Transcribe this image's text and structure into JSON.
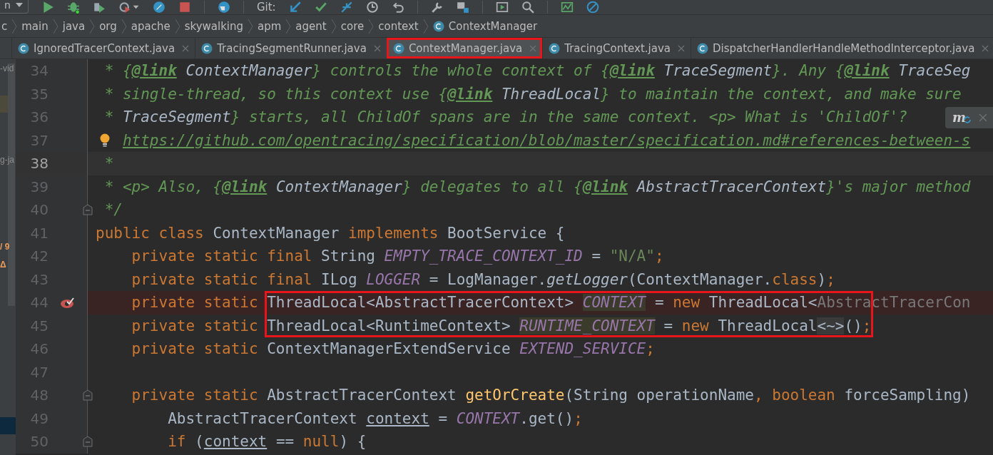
{
  "toolbar": {
    "config_selector": "n",
    "git_label": "Git:"
  },
  "breadcrumbs": [
    "c",
    "main",
    "java",
    "org",
    "apache",
    "skywalking",
    "apm",
    "agent",
    "core",
    "context",
    "ContextManager"
  ],
  "tabs": [
    {
      "label": "IgnoredTracerContext.java",
      "selected": false,
      "highlighted": false
    },
    {
      "label": "TracingSegmentRunner.java",
      "selected": false,
      "highlighted": false
    },
    {
      "label": "ContextManager.java",
      "selected": true,
      "highlighted": true
    },
    {
      "label": "TracingContext.java",
      "selected": false,
      "highlighted": false
    },
    {
      "label": "DispatcherHandlerHandleMethodInterceptor.java",
      "selected": false,
      "highlighted": false
    }
  ],
  "project_panel": {
    "fragments": [
      {
        "text": "-vid",
        "kind": "name"
      },
      {
        "text": "g-ja",
        "kind": "name"
      },
      {
        "text": "/ 9",
        "kind": "count"
      },
      {
        "text": "Δ",
        "kind": "count"
      }
    ]
  },
  "popup": {
    "glyph": "m"
  },
  "lines": [
    {
      "number": "34",
      "current": false,
      "breakpoint": false,
      "boxed": false,
      "bulb": false,
      "fold": false,
      "tokens": [
        {
          "kind": "cm",
          "text": " * {"
        },
        {
          "kind": "tag",
          "text": "@link"
        },
        {
          "kind": "ref",
          "text": " ContextManager"
        },
        {
          "kind": "cm",
          "text": "} controls the whole context of {"
        },
        {
          "kind": "tag",
          "text": "@link"
        },
        {
          "kind": "ref",
          "text": " TraceSegment"
        },
        {
          "kind": "cm",
          "text": "}. Any {"
        },
        {
          "kind": "tag",
          "text": "@link"
        },
        {
          "kind": "ref",
          "text": " TraceSeg"
        }
      ]
    },
    {
      "number": "35",
      "current": false,
      "breakpoint": false,
      "boxed": false,
      "bulb": false,
      "fold": false,
      "tokens": [
        {
          "kind": "cm",
          "text": " * single-thread, so this context use {"
        },
        {
          "kind": "tag",
          "text": "@link"
        },
        {
          "kind": "ref",
          "text": " ThreadLocal"
        },
        {
          "kind": "cm",
          "text": "} to maintain the context, and make sure"
        }
      ]
    },
    {
      "number": "36",
      "current": false,
      "breakpoint": false,
      "boxed": false,
      "bulb": false,
      "fold": false,
      "tokens": [
        {
          "kind": "cm",
          "text": " * "
        },
        {
          "kind": "ref",
          "text": "TraceSegment"
        },
        {
          "kind": "cm",
          "text": "} starts, all ChildOf spans are in the same context. <p> What is 'ChildOf'?"
        }
      ]
    },
    {
      "number": "37",
      "current": false,
      "breakpoint": false,
      "boxed": false,
      "bulb": true,
      "fold": false,
      "tokens": [
        {
          "kind": "url",
          "text": "https://github.com/opentracing/specification/blob/master/specification.md#references-between-s"
        }
      ]
    },
    {
      "number": "38",
      "current": true,
      "breakpoint": false,
      "boxed": false,
      "bulb": false,
      "fold": false,
      "tokens": [
        {
          "kind": "cm",
          "text": " *"
        }
      ]
    },
    {
      "number": "39",
      "current": false,
      "breakpoint": false,
      "boxed": false,
      "bulb": false,
      "fold": false,
      "tokens": [
        {
          "kind": "cm",
          "text": " * <p> Also, {"
        },
        {
          "kind": "tag",
          "text": "@link"
        },
        {
          "kind": "ref",
          "text": " ContextManager"
        },
        {
          "kind": "cm",
          "text": "} delegates to all {"
        },
        {
          "kind": "tag",
          "text": "@link"
        },
        {
          "kind": "ref",
          "text": " AbstractTracerContext"
        },
        {
          "kind": "cm",
          "text": "}'s major method"
        }
      ]
    },
    {
      "number": "40",
      "current": false,
      "breakpoint": false,
      "boxed": false,
      "bulb": false,
      "fold": true,
      "tokens": [
        {
          "kind": "cm",
          "text": " */"
        }
      ]
    },
    {
      "number": "41",
      "current": false,
      "breakpoint": false,
      "boxed": false,
      "bulb": false,
      "fold": false,
      "tokens": [
        {
          "kind": "kw",
          "text": "public class "
        },
        {
          "kind": "plain",
          "text": "ContextManager "
        },
        {
          "kind": "kw",
          "text": "implements "
        },
        {
          "kind": "plain",
          "text": "BootService {"
        }
      ]
    },
    {
      "number": "42",
      "current": false,
      "breakpoint": false,
      "boxed": false,
      "bulb": false,
      "fold": false,
      "tokens": [
        {
          "kind": "kw",
          "text": "    private static final "
        },
        {
          "kind": "plain",
          "text": "String "
        },
        {
          "kind": "field",
          "text": "EMPTY_TRACE_CONTEXT_ID"
        },
        {
          "kind": "plain",
          "text": " = "
        },
        {
          "kind": "str",
          "text": "\"N/A\""
        },
        {
          "kind": "kw",
          "text": ";"
        }
      ]
    },
    {
      "number": "43",
      "current": false,
      "breakpoint": false,
      "boxed": false,
      "bulb": false,
      "fold": false,
      "tokens": [
        {
          "kind": "kw",
          "text": "    private static final "
        },
        {
          "kind": "plain",
          "text": "ILog "
        },
        {
          "kind": "field",
          "text": "LOGGER"
        },
        {
          "kind": "plain",
          "text": " = LogManager."
        },
        {
          "kind": "call",
          "text": "getLogger"
        },
        {
          "kind": "plain",
          "text": "(ContextManager."
        },
        {
          "kind": "kw",
          "text": "class"
        },
        {
          "kind": "plain",
          "text": ")"
        },
        {
          "kind": "kw",
          "text": ";"
        }
      ]
    },
    {
      "number": "44",
      "current": false,
      "breakpoint": true,
      "boxed": true,
      "bulb": false,
      "fold": false,
      "tokens": [
        {
          "kind": "kw",
          "text": "    private static "
        },
        {
          "kind": "plain",
          "text": "ThreadLocal<AbstractTracerContext> "
        },
        {
          "kind": "usage",
          "text": "CONTEXT"
        },
        {
          "kind": "plain",
          "text": " = "
        },
        {
          "kind": "kw",
          "text": "new "
        },
        {
          "kind": "plain",
          "text": "ThreadLocal<"
        },
        {
          "kind": "dim",
          "text": "AbstractTracerCon"
        }
      ]
    },
    {
      "number": "45",
      "current": false,
      "breakpoint": false,
      "boxed": true,
      "bulb": false,
      "fold": false,
      "tokens": [
        {
          "kind": "kw",
          "text": "    private static "
        },
        {
          "kind": "plain",
          "text": "ThreadLocal<RuntimeContext> "
        },
        {
          "kind": "usage",
          "text": "RUNTIME_CONTEXT"
        },
        {
          "kind": "plain",
          "text": " = "
        },
        {
          "kind": "kw",
          "text": "new "
        },
        {
          "kind": "plain",
          "text": "ThreadLocal"
        },
        {
          "kind": "fold",
          "text": "<~>"
        },
        {
          "kind": "plain",
          "text": "()"
        },
        {
          "kind": "kw",
          "text": ";"
        }
      ]
    },
    {
      "number": "46",
      "current": false,
      "breakpoint": false,
      "boxed": false,
      "bulb": false,
      "fold": false,
      "tokens": [
        {
          "kind": "kw",
          "text": "    private static "
        },
        {
          "kind": "plain",
          "text": "ContextManagerExtendService "
        },
        {
          "kind": "field",
          "text": "EXTEND_SERVICE"
        },
        {
          "kind": "kw",
          "text": ";"
        }
      ]
    },
    {
      "number": "47",
      "current": false,
      "breakpoint": false,
      "boxed": false,
      "bulb": false,
      "fold": false
    },
    {
      "number": "48",
      "current": false,
      "breakpoint": false,
      "boxed": false,
      "bulb": false,
      "fold": true,
      "tokens": [
        {
          "kind": "kw",
          "text": "    private static "
        },
        {
          "kind": "plain",
          "text": "AbstractTracerContext "
        },
        {
          "kind": "method",
          "text": "getOrCreate"
        },
        {
          "kind": "plain",
          "text": "(String operationName"
        },
        {
          "kind": "kw",
          "text": ", boolean "
        },
        {
          "kind": "plain",
          "text": "forceSampling)"
        }
      ]
    },
    {
      "number": "49",
      "current": false,
      "breakpoint": false,
      "boxed": false,
      "bulb": false,
      "fold": false,
      "tokens": [
        {
          "kind": "plain",
          "text": "        AbstractTracerContext "
        },
        {
          "kind": "under",
          "text": "context"
        },
        {
          "kind": "plain",
          "text": " = "
        },
        {
          "kind": "field",
          "text": "CONTEXT"
        },
        {
          "kind": "plain",
          "text": ".get()"
        },
        {
          "kind": "kw",
          "text": ";"
        }
      ]
    },
    {
      "number": "50",
      "current": false,
      "breakpoint": false,
      "boxed": false,
      "bulb": false,
      "fold": true,
      "tokens": [
        {
          "kind": "kw",
          "text": "        if "
        },
        {
          "kind": "plain",
          "text": "("
        },
        {
          "kind": "under",
          "text": "context"
        },
        {
          "kind": "plain",
          "text": " == "
        },
        {
          "kind": "kw",
          "text": "null"
        },
        {
          "kind": "plain",
          "text": ") {"
        }
      ]
    }
  ]
}
